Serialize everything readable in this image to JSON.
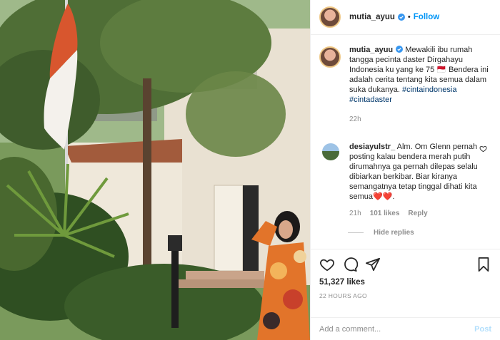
{
  "post": {
    "username": "mutia_ayuu",
    "follow_label": "Follow",
    "separator": "•",
    "caption_text": "Mewakili ibu rumah tangga pecinta daster Dirgahayu Indonesia ku yang ke 75 🇲🇨 Bendera ini adalah cerita tentang kita semua dalam suka dukanya.",
    "hashtag_1": "#cintaindonesia",
    "hashtag_2": "#cintadaster",
    "caption_age": "22h",
    "likes": "51,327 likes",
    "timestamp": "22 HOURS AGO"
  },
  "reply": {
    "username": "desiayulstr_",
    "text": "Alm. Om Glenn pernah posting kalau bendera merah putih dirumahnya ga pernah dilepas selalu dibiarkan berkibar. Biar kiranya semangatnya tetap tinggal dihati kita semua❤️❤️.",
    "age": "21h",
    "likes": "101 likes",
    "reply_label": "Reply",
    "hide_replies": "Hide replies"
  },
  "comment_box": {
    "placeholder": "Add a comment...",
    "post_label": "Post"
  },
  "colors": {
    "accent": "#0095f6",
    "verified": "#3897f0",
    "post_disabled": "#b2dffc"
  },
  "icons": [
    "verified-icon",
    "heart-icon",
    "comment-icon",
    "share-icon",
    "bookmark-icon"
  ]
}
